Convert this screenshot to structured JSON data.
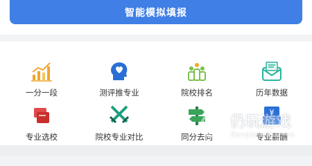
{
  "main_button": {
    "label": "智能模拟填报",
    "color": "#3f7fe6"
  },
  "grid_items": [
    {
      "label": "一分一段",
      "icon": "bar-chart-icon",
      "color": "#f2a52b"
    },
    {
      "label": "测评推专业",
      "icon": "head-heart-icon",
      "color": "#2a6fd6"
    },
    {
      "label": "院校排名",
      "icon": "ranking-podium-icon",
      "color": "#7cc04a"
    },
    {
      "label": "历年数据",
      "icon": "mail-envelope-icon",
      "color": "#2ab39a"
    },
    {
      "label": "专业选校",
      "icon": "books-icon",
      "color": "#e24a4a"
    },
    {
      "label": "院校专业对比",
      "icon": "crossed-swords-icon",
      "color": "#1e9e7c"
    },
    {
      "label": "同分去向",
      "icon": "signpost-icon",
      "color": "#3aa55a"
    },
    {
      "label": "专业薪酬",
      "icon": "yen-wallet-icon",
      "color": "#2a6fd6"
    }
  ],
  "watermark": {
    "title": "仍玩游戏",
    "subtitle": "Rengwan Games"
  }
}
